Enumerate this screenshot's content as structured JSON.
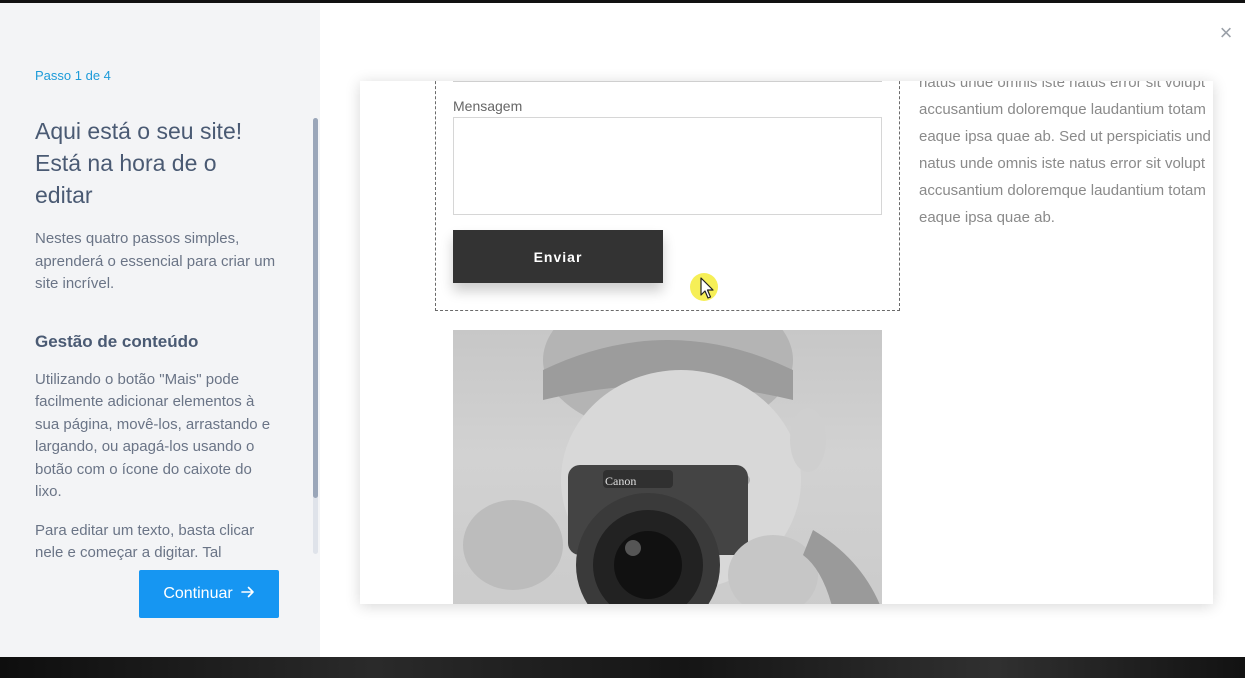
{
  "step": {
    "label": "Passo 1 de 4"
  },
  "sidebar": {
    "headline": "Aqui está o seu site! Está na hora de o editar",
    "intro": "Nestes quatro passos simples, aprenderá o essencial para criar um site incrível.",
    "section_title": "Gestão de conteúdo",
    "paragraph_1": "Utilizando o botão \"Mais\" pode facilmente adicionar elementos à sua página, movê-los, arrastando e largando, ou apagá-los usando o botão com o ícone do caixote do lixo.",
    "paragraph_2": "Para editar um texto, basta clicar nele e começar a digitar. Tal"
  },
  "continue_button": {
    "label": "Continuar",
    "icon": "arrow-right-icon"
  },
  "close_button": {
    "icon": "close-icon",
    "glyph": "×"
  },
  "preview": {
    "message_label": "Mensagem",
    "send_label": "Enviar",
    "body_lines": [
      "natus unde omnis iste natus error sit volupt",
      "accusantium doloremque laudantium totam",
      "eaque ipsa quae ab. Sed ut perspiciatis und",
      "natus unde omnis iste natus error sit volupt",
      "accusantium doloremque laudantium totam",
      "eaque ipsa quae ab."
    ],
    "camera_brand": "Canon"
  },
  "colors": {
    "accent": "#1696f2",
    "step_label": "#1d9bd9",
    "heading": "#4a5a73",
    "body": "#6a7486",
    "send_button": "#333333",
    "cursor_highlight": "#f5ec3a"
  }
}
